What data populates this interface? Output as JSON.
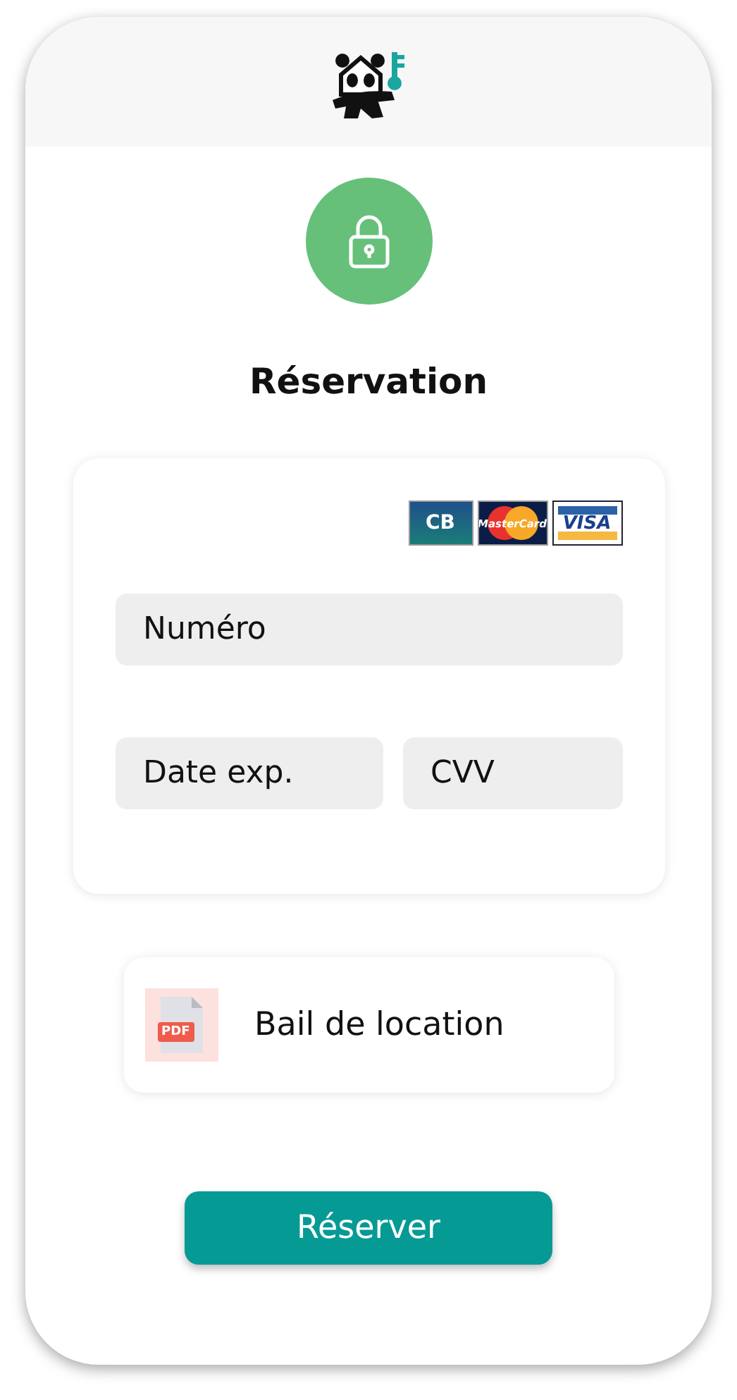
{
  "title": "Réservation",
  "card_logos": [
    {
      "kind": "cb",
      "label": "CB"
    },
    {
      "kind": "mastercard",
      "label": "MasterCard"
    },
    {
      "kind": "visa",
      "label": "VISA"
    }
  ],
  "fields": {
    "number": {
      "placeholder": "Numéro"
    },
    "expiry": {
      "placeholder": "Date exp."
    },
    "cvv": {
      "placeholder": "CVV"
    }
  },
  "document": {
    "badge": "PDF",
    "label": "Bail de location"
  },
  "submit": "Réserver"
}
